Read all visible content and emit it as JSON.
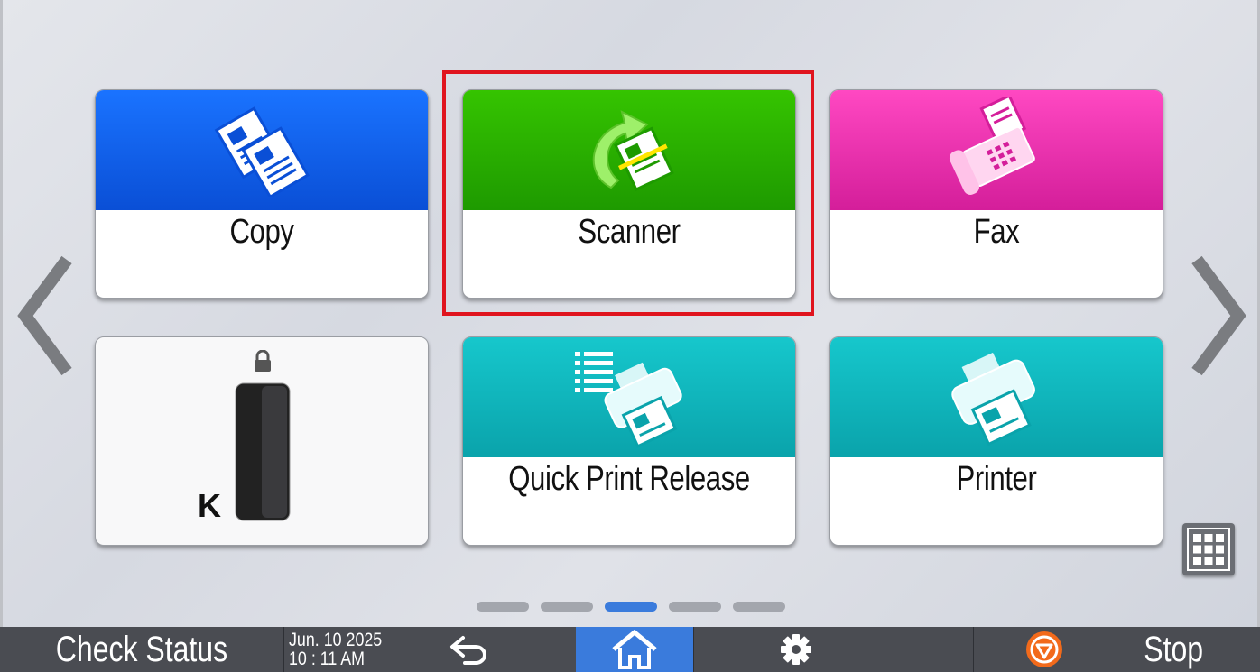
{
  "apps": {
    "copy": {
      "label": "Copy",
      "icon": "copy-icon",
      "color": "#0a5cf0"
    },
    "scanner": {
      "label": "Scanner",
      "icon": "scanner-icon",
      "color": "#28b000"
    },
    "fax": {
      "label": "Fax",
      "icon": "fax-icon",
      "color": "#ec2fb0"
    },
    "toner": {
      "letter": "K",
      "icon": "toner-cartridge-icon",
      "lock_icon": "lock-icon",
      "level": 1.0
    },
    "quick_print": {
      "label": "Quick Print Release",
      "icon": "quick-print-release-icon",
      "color": "#10b7bd"
    },
    "printer": {
      "label": "Printer",
      "icon": "printer-icon",
      "color": "#10b7bd"
    }
  },
  "navigation": {
    "prev_icon": "chevron-left-icon",
    "next_icon": "chevron-right-icon",
    "page_count": 5,
    "current_page": 3,
    "app_list_icon": "grid-icon"
  },
  "bottom_bar": {
    "check_status": "Check Status",
    "date": "Jun. 10 2025",
    "time": "10 : 11 AM",
    "back_icon": "back-arrow-icon",
    "home_icon": "home-icon",
    "settings_icon": "gear-icon",
    "stop_icon": "stop-icon",
    "stop_label": "Stop"
  },
  "colors": {
    "highlight": "#e0141e",
    "active_dot": "#3a7bdc",
    "home_active": "#3a7bdc"
  }
}
